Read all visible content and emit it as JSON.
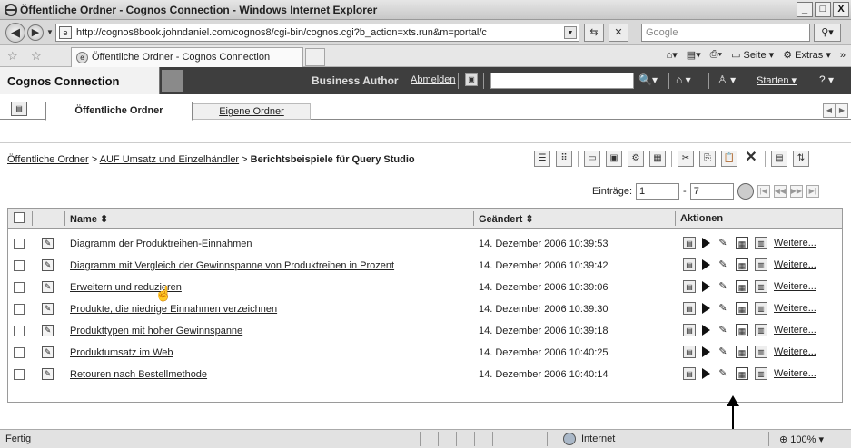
{
  "window": {
    "title": "Öffentliche Ordner - Cognos Connection - Windows Internet Explorer",
    "controls": [
      "_",
      "□",
      "X"
    ]
  },
  "address": {
    "url": "http://cognos8book.johndaniel.com/cognos8/cgi-bin/cognos.cgi?b_action=xts.run&m=portal/c",
    "search_placeholder": "Google"
  },
  "browser_tab": {
    "label": "Öffentliche Ordner - Cognos Connection"
  },
  "command_bar": {
    "seite": "Seite",
    "extras": "Extras"
  },
  "cognos_header": {
    "title": "Cognos Connection",
    "role": "Business Author",
    "logout": "Abmelden",
    "start": "Starten",
    "help": "?"
  },
  "tabs": {
    "public": "Öffentliche Ordner",
    "my": "Eigene Ordner"
  },
  "breadcrumb": {
    "root": "Öffentliche Ordner",
    "sep1": ">",
    "parent": "AUF Umsatz und Einzelhändler",
    "sep2": ">",
    "current": "Berichtsbeispiele für Query Studio"
  },
  "pager": {
    "label": "Einträge:",
    "from": "1",
    "dash": "-",
    "to": "7"
  },
  "table": {
    "headers": {
      "name": "Name ⇕",
      "modified": "Geändert ⇕",
      "actions": "Aktionen"
    },
    "rows": [
      {
        "name": "Diagramm der Produktreihen-Einnahmen",
        "modified": "14. Dezember 2006 10:39:53",
        "more": "Weitere..."
      },
      {
        "name": "Diagramm mit Vergleich der Gewinnspanne von Produktreihen in Prozent",
        "modified": "14. Dezember 2006 10:39:42",
        "more": "Weitere..."
      },
      {
        "name": "Erweitern und reduzieren",
        "modified": "14. Dezember 2006 10:39:06",
        "more": "Weitere..."
      },
      {
        "name": "Produkte, die niedrige Einnahmen verzeichnen",
        "modified": "14. Dezember 2006 10:39:30",
        "more": "Weitere..."
      },
      {
        "name": "Produkttypen mit hoher Gewinnspanne",
        "modified": "14. Dezember 2006 10:39:18",
        "more": "Weitere..."
      },
      {
        "name": "Produktumsatz im Web",
        "modified": "14. Dezember 2006 10:40:25",
        "more": "Weitere..."
      },
      {
        "name": "Retouren nach Bestellmethode",
        "modified": "14. Dezember 2006 10:40:14",
        "more": "Weitere..."
      }
    ]
  },
  "status": {
    "text": "Fertig",
    "zone": "Internet",
    "zoom": "100%"
  }
}
